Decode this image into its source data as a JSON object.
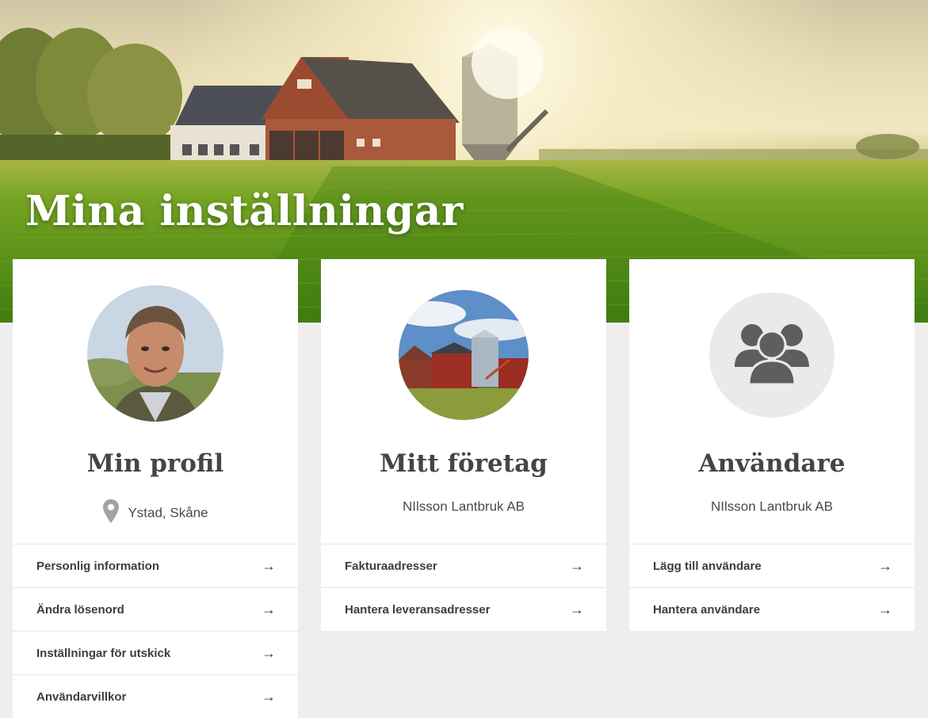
{
  "page": {
    "title": "Mina inställningar"
  },
  "cards": [
    {
      "title": "Min profil",
      "subtitle": "Ystad, Skåne",
      "avatar_icon": "profile-photo",
      "subtitle_icon": "location-pin-icon",
      "links": [
        {
          "label": "Personlig information"
        },
        {
          "label": "Ändra lösenord"
        },
        {
          "label": "Inställningar för utskick"
        },
        {
          "label": "Användarvillkor"
        }
      ]
    },
    {
      "title": "Mitt företag",
      "subtitle": "NIlsson Lantbruk AB",
      "avatar_icon": "farm-photo",
      "links": [
        {
          "label": "Fakturaadresser"
        },
        {
          "label": "Hantera leveransadresser"
        }
      ]
    },
    {
      "title": "Användare",
      "subtitle": "NIlsson Lantbruk AB",
      "avatar_icon": "users-group-icon",
      "links": [
        {
          "label": "Lägg till användare"
        },
        {
          "label": "Hantera användare"
        }
      ]
    }
  ],
  "arrow_glyph": "→",
  "colors": {
    "background": "#efeeec",
    "card": "#ffffff",
    "text": "#3d3d3d",
    "field_green": "#5f961d"
  }
}
